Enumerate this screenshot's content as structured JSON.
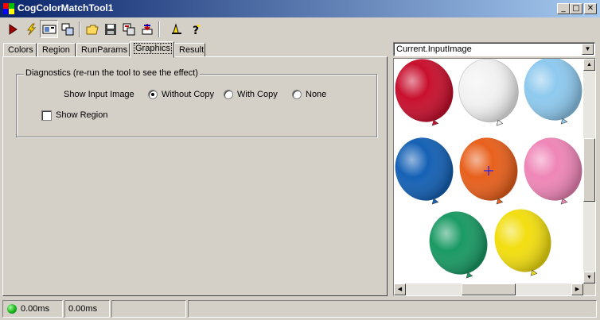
{
  "window": {
    "title": "CogColorMatchTool1",
    "minimize_glyph": "_",
    "maximize_glyph": "□",
    "close_glyph": "✕"
  },
  "toolbar": {
    "buttons": [
      {
        "name": "run-icon"
      },
      {
        "name": "electric-icon"
      },
      {
        "name": "display-toggle-icon"
      },
      {
        "name": "floating-display-icon"
      },
      {
        "name": "open-folder-icon"
      },
      {
        "name": "save-icon"
      },
      {
        "name": "reset-icon"
      },
      {
        "name": "load-icon"
      },
      {
        "name": "region-tool-icon"
      },
      {
        "name": "help-icon"
      }
    ]
  },
  "tabs": [
    {
      "label": "Colors",
      "active": false
    },
    {
      "label": "Region",
      "active": false
    },
    {
      "label": "RunParams",
      "active": false
    },
    {
      "label": "Graphics",
      "active": true
    },
    {
      "label": "Result",
      "active": false
    }
  ],
  "diagnostics": {
    "group_label": "Diagnostics (re-run the tool to see the effect)",
    "show_input_image_label": "Show Input Image",
    "options": [
      {
        "label": "Without Copy",
        "checked": true
      },
      {
        "label": "With Copy",
        "checked": false
      },
      {
        "label": "None",
        "checked": false
      }
    ],
    "show_region_label": "Show Region",
    "show_region_checked": false
  },
  "image_selector": {
    "selected": "Current.InputImage"
  },
  "image": {
    "balloons": [
      {
        "color": "#c8102e"
      },
      {
        "color": "#f2f2f2"
      },
      {
        "color": "#8ec9ee"
      },
      {
        "color": "#1561b5"
      },
      {
        "color": "#e8601c"
      },
      {
        "color": "#ef86b7"
      },
      {
        "color": "#1a9a64"
      },
      {
        "color": "#f2de10"
      }
    ]
  },
  "status": {
    "time1": "0.00ms",
    "time2": "0.00ms",
    "led_color": "#18b418"
  }
}
